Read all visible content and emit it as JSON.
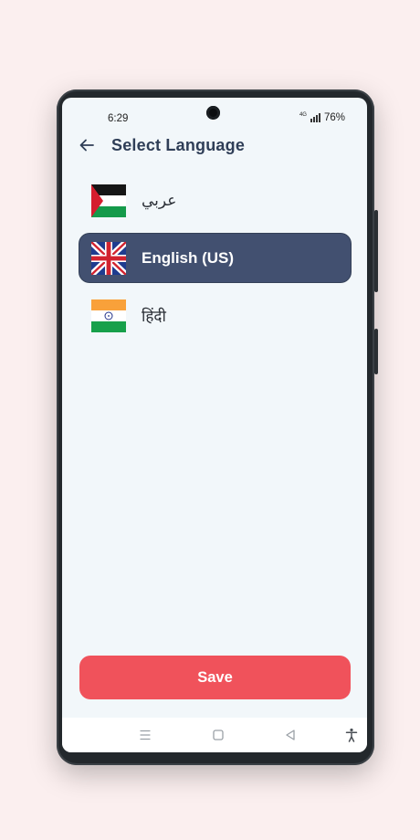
{
  "status_bar": {
    "time": "6:29",
    "network": "4G",
    "battery": "76%"
  },
  "header": {
    "title": "Select Language",
    "back_icon": "arrow-left-icon"
  },
  "languages": [
    {
      "label": "عربي",
      "flag": "palestine-flag-icon",
      "selected": false
    },
    {
      "label": "English (US)",
      "flag": "uk-flag-icon",
      "selected": true
    },
    {
      "label": "हिंदी",
      "flag": "india-flag-icon",
      "selected": false
    }
  ],
  "save_button": {
    "label": "Save"
  },
  "nav_bar": {
    "icons": [
      "recents-icon",
      "home-icon",
      "back-icon",
      "accessibility-icon"
    ]
  },
  "colors": {
    "selected_background": "#425070",
    "save_button": "#f0525b",
    "title": "#2f3e57",
    "screen_background": "#f2f7fa"
  }
}
